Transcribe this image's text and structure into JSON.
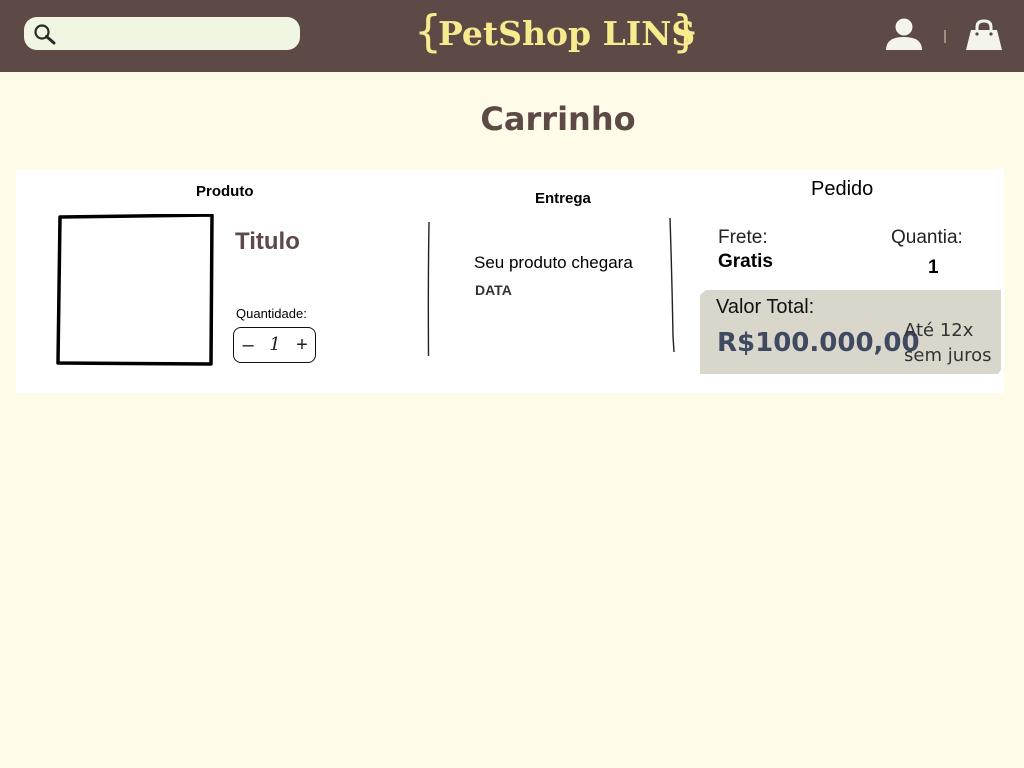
{
  "header": {
    "search_placeholder": "",
    "brand_open": "{",
    "brand_name": "PetShop LINS",
    "brand_close": "}",
    "colors": {
      "bar": "#5d4a47",
      "brand": "#f7eb8e",
      "search_bg": "#f1f6e2"
    },
    "icons": [
      "search-icon",
      "user-icon",
      "shopping-bag-icon"
    ]
  },
  "page": {
    "title": "Carrinho",
    "background": "#fefce8"
  },
  "cart": {
    "columns": {
      "product": "Produto",
      "delivery": "Entrega",
      "order": "Pedido"
    },
    "product": {
      "title": "Titulo",
      "quantity_label": "Quantidade:",
      "quantity_value": "1",
      "minus": "–",
      "plus": "+"
    },
    "delivery": {
      "message": "Seu produto chegara",
      "date": "DATA"
    },
    "order": {
      "shipping_label": "Frete:",
      "shipping_value": "Gratis",
      "quantity_label": "Quantia:",
      "quantity_value": "1",
      "total_label": "Valor Total:",
      "total_value": "R$100.000,00",
      "installments_line1": "Até 12x",
      "installments_line2": "sem juros"
    }
  }
}
